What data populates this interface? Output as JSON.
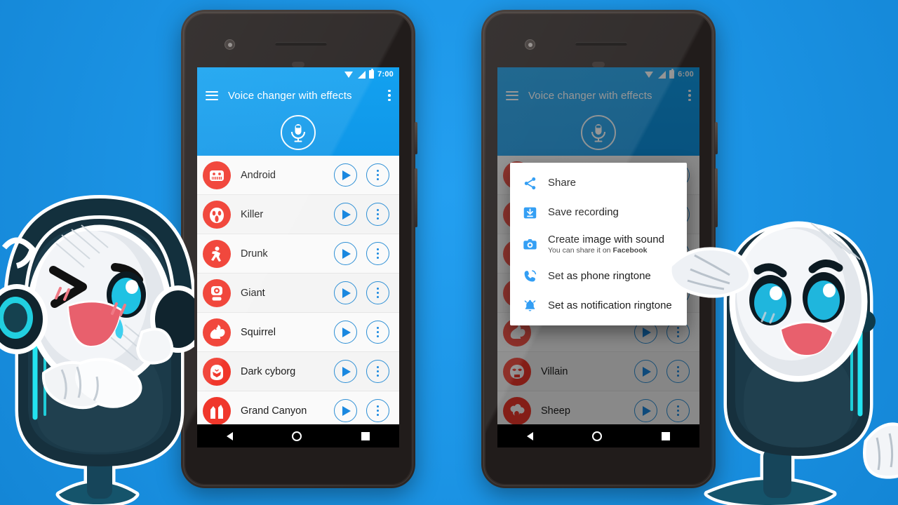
{
  "background": {
    "color": "#1c95e6"
  },
  "accent": {
    "brand_blue": "#1a9ae8",
    "avatar_red": "#f0372b",
    "icon_blue": "#1a88e0"
  },
  "phones": [
    {
      "id": "left",
      "status_bar": {
        "time": "7:00",
        "wifi_icon": "wifi-icon",
        "signal_icon": "signal-icon",
        "battery_icon": "battery-icon"
      },
      "app_bar": {
        "menu_icon": "hamburger-menu-icon",
        "title": "Voice changer with effects",
        "overflow_icon": "overflow-menu-icon"
      },
      "mic_button": {
        "icon": "microphone-icon"
      },
      "effects": [
        {
          "name": "Android",
          "avatar_icon": "robot-face-icon",
          "play_icon": "play-icon",
          "more_icon": "overflow-menu-icon"
        },
        {
          "name": "Killer",
          "avatar_icon": "scream-mask-icon",
          "play_icon": "play-icon",
          "more_icon": "overflow-menu-icon"
        },
        {
          "name": "Drunk",
          "avatar_icon": "stumbling-person-icon",
          "play_icon": "play-icon",
          "more_icon": "overflow-menu-icon"
        },
        {
          "name": "Giant",
          "avatar_icon": "giant-head-icon",
          "play_icon": "play-icon",
          "more_icon": "overflow-menu-icon"
        },
        {
          "name": "Squirrel",
          "avatar_icon": "squirrel-icon",
          "play_icon": "play-icon",
          "more_icon": "overflow-menu-icon"
        },
        {
          "name": "Dark cyborg",
          "avatar_icon": "cyborg-helmet-icon",
          "play_icon": "play-icon",
          "more_icon": "overflow-menu-icon"
        },
        {
          "name": "Grand Canyon",
          "avatar_icon": "canyon-icon",
          "play_icon": "play-icon",
          "more_icon": "overflow-menu-icon"
        }
      ],
      "nav_bar": {
        "back_icon": "back-triangle-icon",
        "home_icon": "home-circle-icon",
        "recents_icon": "recents-square-icon"
      }
    },
    {
      "id": "right",
      "status_bar": {
        "time": "6:00",
        "wifi_icon": "wifi-icon",
        "signal_icon": "signal-icon",
        "battery_icon": "battery-icon"
      },
      "app_bar": {
        "menu_icon": "hamburger-menu-icon",
        "title": "Voice changer with effects",
        "overflow_icon": "overflow-menu-icon"
      },
      "mic_button": {
        "icon": "microphone-icon"
      },
      "effects": [
        {
          "name": "",
          "avatar_icon": "robot-face-icon",
          "play_icon": "play-icon",
          "more_icon": "overflow-menu-icon"
        },
        {
          "name": "",
          "avatar_icon": "scream-mask-icon",
          "play_icon": "play-icon",
          "more_icon": "overflow-menu-icon"
        },
        {
          "name": "",
          "avatar_icon": "stumbling-person-icon",
          "play_icon": "play-icon",
          "more_icon": "overflow-menu-icon"
        },
        {
          "name": "",
          "avatar_icon": "giant-head-icon",
          "play_icon": "play-icon",
          "more_icon": "overflow-menu-icon"
        },
        {
          "name": "",
          "avatar_icon": "squirrel-icon",
          "play_icon": "play-icon",
          "more_icon": "overflow-menu-icon"
        },
        {
          "name": "Villain",
          "avatar_icon": "villain-mask-icon",
          "play_icon": "play-icon",
          "more_icon": "overflow-menu-icon"
        },
        {
          "name": "Sheep",
          "avatar_icon": "sheep-icon",
          "play_icon": "play-icon",
          "more_icon": "overflow-menu-icon"
        }
      ],
      "nav_bar": {
        "back_icon": "back-triangle-icon",
        "home_icon": "home-circle-icon",
        "recents_icon": "recents-square-icon"
      },
      "popup_menu": {
        "items": [
          {
            "label": "Share",
            "sub": "",
            "sub_bold": "",
            "icon": "share-icon"
          },
          {
            "label": "Save recording",
            "sub": "",
            "sub_bold": "",
            "icon": "save-download-icon"
          },
          {
            "label": "Create image with sound",
            "sub": "You can share it on ",
            "sub_bold": "Facebook",
            "icon": "camera-icon"
          },
          {
            "label": "Set as phone ringtone",
            "sub": "",
            "sub_bold": "",
            "icon": "phone-ringing-icon"
          },
          {
            "label": "Set as notification ringtone",
            "sub": "",
            "sub_bold": "",
            "icon": "bell-icon"
          }
        ]
      }
    }
  ],
  "mascots": [
    {
      "id": "left-mascot",
      "name": "winking-microphone-mascot"
    },
    {
      "id": "right-mascot",
      "name": "waving-microphone-mascot"
    }
  ]
}
